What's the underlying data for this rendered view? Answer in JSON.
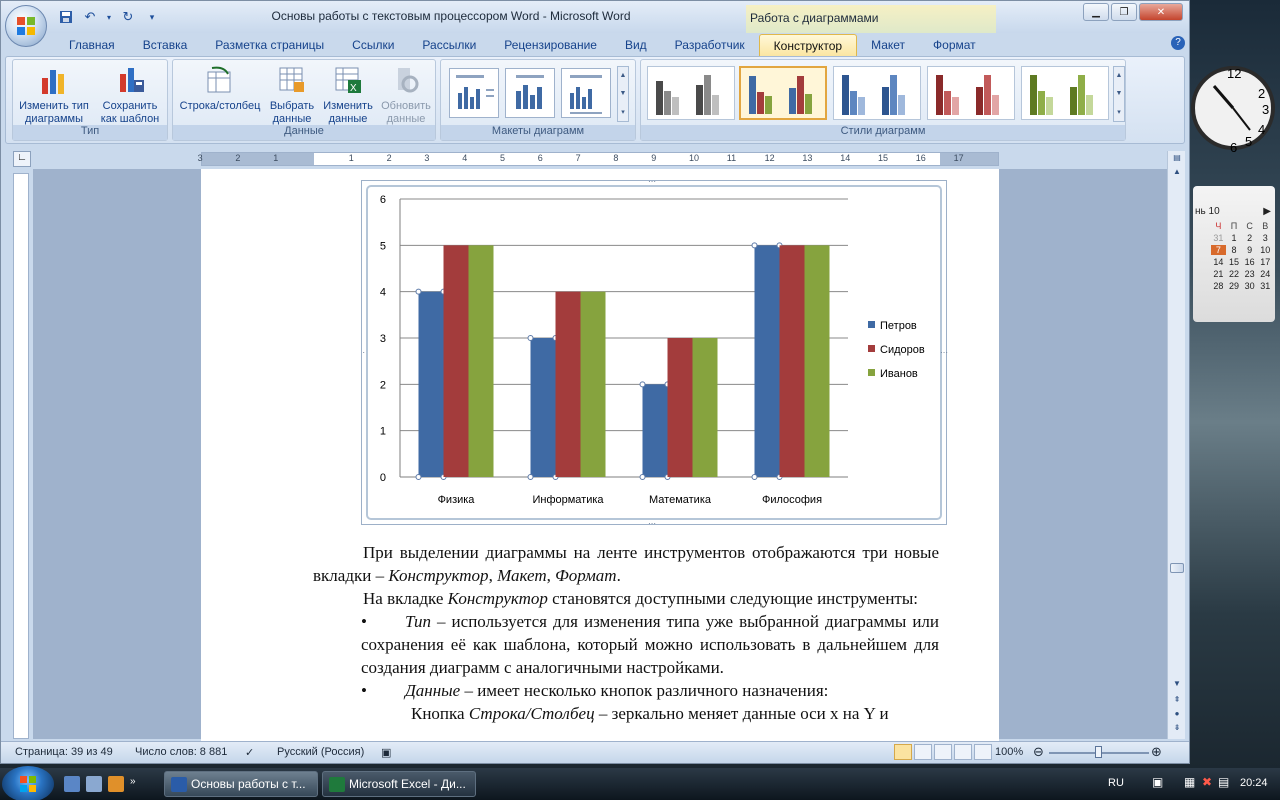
{
  "window": {
    "title": "Основы работы с текстовым процессором Word - Microsoft Word",
    "context_title": "Работа с диаграммами"
  },
  "tabs": [
    {
      "label": "Главная"
    },
    {
      "label": "Вставка"
    },
    {
      "label": "Разметка страницы"
    },
    {
      "label": "Ссылки"
    },
    {
      "label": "Рассылки"
    },
    {
      "label": "Рецензирование"
    },
    {
      "label": "Вид"
    },
    {
      "label": "Разработчик"
    },
    {
      "label": "Конструктор"
    },
    {
      "label": "Макет"
    },
    {
      "label": "Формат"
    }
  ],
  "active_tab": "Конструктор",
  "ribbon": {
    "type_group": {
      "label": "Тип",
      "change_type_l1": "Изменить тип",
      "change_type_l2": "диаграммы",
      "save_template_l1": "Сохранить",
      "save_template_l2": "как шаблон"
    },
    "data_group": {
      "label": "Данные",
      "row_col": "Строка/столбец",
      "select_l1": "Выбрать",
      "select_l2": "данные",
      "edit_l1": "Изменить",
      "edit_l2": "данные",
      "refresh_l1": "Обновить",
      "refresh_l2": "данные"
    },
    "layouts_group": {
      "label": "Макеты диаграмм"
    },
    "styles_group": {
      "label": "Стили диаграмм"
    }
  },
  "chart_data": {
    "type": "bar",
    "categories": [
      "Физика",
      "Информатика",
      "Математика",
      "Философия"
    ],
    "series": [
      {
        "name": "Петров",
        "values": [
          4,
          3,
          2,
          5
        ],
        "color": "#3f6aa4"
      },
      {
        "name": "Сидоров",
        "values": [
          5,
          4,
          3,
          5
        ],
        "color": "#a33c3c"
      },
      {
        "name": "Иванов",
        "values": [
          5,
          4,
          3,
          5
        ],
        "color": "#86a33e"
      }
    ],
    "ylim": [
      0,
      6
    ],
    "yticks": [
      "0",
      "1",
      "2",
      "3",
      "4",
      "5",
      "6"
    ],
    "grid": true,
    "legend": "right"
  },
  "document": {
    "p1_a": "При выделении диаграммы на ленте инструментов отображаются три новые вкладки – ",
    "p1_em1": "Конструктор",
    "p1_sep1": ", ",
    "p1_em2": "Макет",
    "p1_sep2": ", ",
    "p1_em3": "Формат",
    "p1_end": ".",
    "p2_a": "На вкладке ",
    "p2_em": "Конструктор",
    "p2_b": " становятся доступными следующие инструменты:",
    "b1_em": "Тип",
    "b1_text": " – используется для изменения типа уже выбранной диаграммы или сохранения её как шаблона, который можно использовать в дальнейшем для создания диаграмм с аналогичными настройками.",
    "b2_em": "Данные",
    "b2_text": " – имеет несколько кнопок различного назначения:",
    "p3_a": "Кнопка ",
    "p3_em": "Строка/Столбец",
    "p3_b": " – зеркально меняет данные оси x на Y и",
    "bullet": "•"
  },
  "ruler_numbers": [
    "3",
    "2",
    "1",
    "1",
    "2",
    "3",
    "4",
    "5",
    "6",
    "7",
    "8",
    "9",
    "10",
    "11",
    "12",
    "13",
    "14",
    "15",
    "16",
    "17"
  ],
  "statusbar": {
    "page": "Страница: 39 из 49",
    "words": "Число слов: 8 881",
    "language": "Русский (Россия)",
    "zoom": "100%"
  },
  "calendar": {
    "month": "нь 10",
    "dow": [
      "Ч",
      "П",
      "С",
      "В"
    ],
    "rows": [
      [
        "31",
        "1",
        "2",
        "3"
      ],
      [
        "7",
        "8",
        "9",
        "10"
      ],
      [
        "14",
        "15",
        "16",
        "17"
      ],
      [
        "21",
        "22",
        "23",
        "24"
      ],
      [
        "28",
        "29",
        "30",
        "31"
      ]
    ],
    "today": "7"
  },
  "clock": {
    "n12": "12",
    "n2": "2",
    "n3": "3",
    "n4": "4",
    "n5": "5",
    "n6": "6"
  },
  "taskbar": {
    "word_task": "Основы работы с т...",
    "excel_task": "Microsoft Excel - Ди...",
    "lang": "RU",
    "time": "20:24"
  },
  "colors": {
    "accent": "#15428b",
    "ribbon": "#d4e1f1",
    "selected": "#e2a640"
  }
}
